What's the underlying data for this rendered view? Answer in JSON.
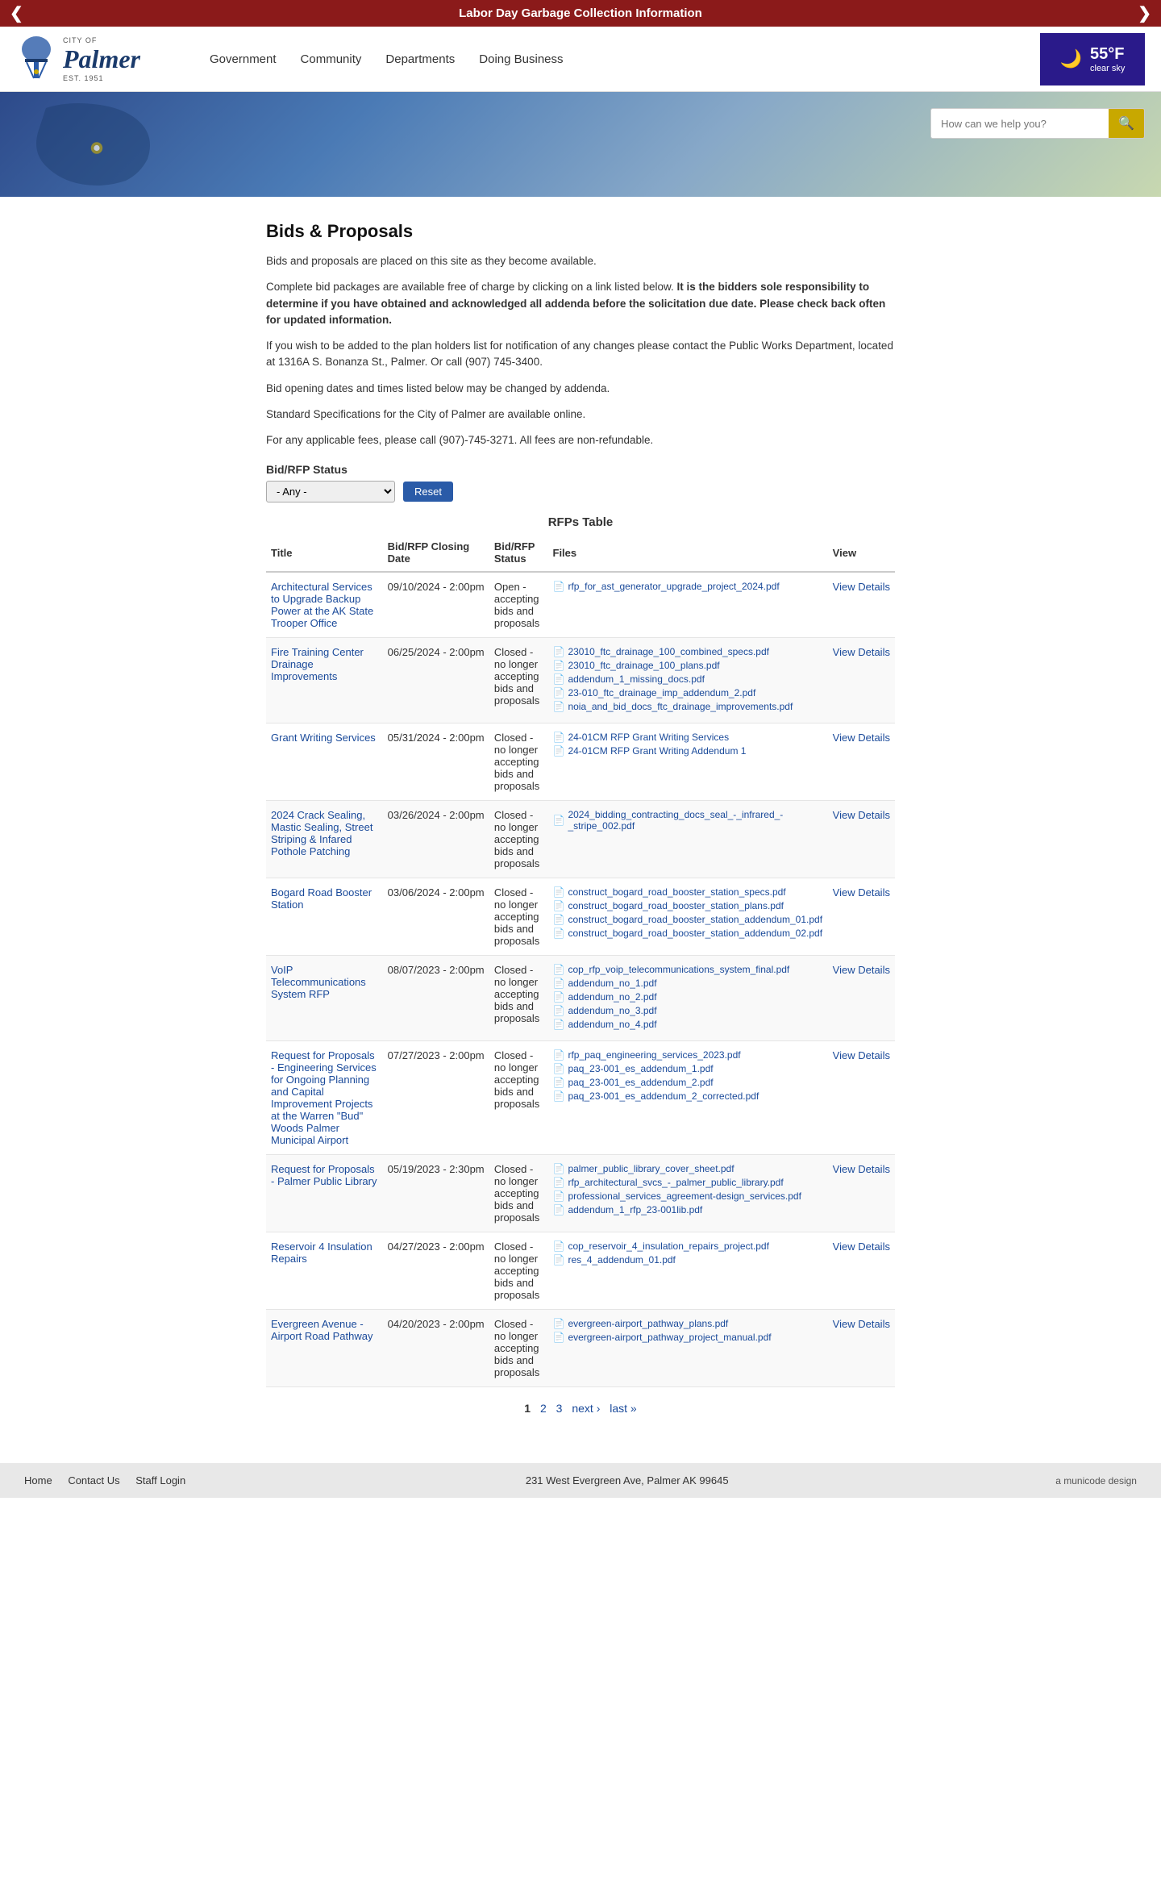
{
  "banner": {
    "text": "Labor Day Garbage Collection Information",
    "prev_label": "❮",
    "next_label": "❯"
  },
  "header": {
    "logo_city": "CITY OF",
    "logo_name": "Palmer",
    "logo_est": "EST. 1951",
    "nav_items": [
      {
        "label": "Government",
        "href": "#"
      },
      {
        "label": "Community",
        "href": "#"
      },
      {
        "label": "Departments",
        "href": "#"
      },
      {
        "label": "Doing Business",
        "href": "#"
      }
    ],
    "weather": {
      "temp": "55°F",
      "desc": "clear sky"
    },
    "search_placeholder": "How can we help you?"
  },
  "page": {
    "title": "Bids & Proposals",
    "intro_1": "Bids and proposals are placed on this site as they become available.",
    "intro_2_plain": "Complete bid packages are available free of charge by clicking on a link listed below. ",
    "intro_2_bold": "It is the bidders sole responsibility to determine if you have obtained and acknowledged all addenda before the solicitation due date. Please check back often for updated information.",
    "intro_3": "If you wish to be added to the plan holders list for notification of any changes please contact the Public Works Department, located at 1316A S. Bonanza St., Palmer. Or call (907) 745-3400.",
    "intro_4": "Bid opening dates and times listed below may be changed by addenda.",
    "intro_5": "Standard Specifications for the City of Palmer are available online.",
    "intro_6": "For any applicable fees, please call (907)-745-3271. All fees are non-refundable.",
    "filter_label": "Bid/RFP Status",
    "filter_default": "- Any -",
    "reset_label": "Reset",
    "table_title": "RFPs Table",
    "col_title": "Title",
    "col_closing": "Bid/RFP Closing Date",
    "col_status": "Bid/RFP Status",
    "col_files": "Files",
    "col_view": "View"
  },
  "rows": [
    {
      "title": "Architectural Services to Upgrade Backup Power at the AK State Trooper Office",
      "closing": "09/10/2024 - 2:00pm",
      "status": "Open - accepting bids and proposals",
      "files": [
        {
          "name": "rfp_for_ast_generator_upgrade_project_2024.pdf"
        }
      ],
      "view": "View Details"
    },
    {
      "title": "Fire Training Center Drainage Improvements",
      "closing": "06/25/2024 - 2:00pm",
      "status": "Closed - no longer accepting bids and proposals",
      "files": [
        {
          "name": "23010_ftc_drainage_100_combined_specs.pdf"
        },
        {
          "name": "23010_ftc_drainage_100_plans.pdf"
        },
        {
          "name": "addendum_1_missing_docs.pdf"
        },
        {
          "name": "23-010_ftc_drainage_imp_addendum_2.pdf"
        },
        {
          "name": "noia_and_bid_docs_ftc_drainage_improvements.pdf"
        }
      ],
      "view": "View Details"
    },
    {
      "title": "Grant Writing Services",
      "closing": "05/31/2024 - 2:00pm",
      "status": "Closed - no longer accepting bids and proposals",
      "files": [
        {
          "name": "24-01CM RFP Grant Writing Services"
        },
        {
          "name": "24-01CM RFP Grant Writing Addendum 1"
        }
      ],
      "view": "View Details"
    },
    {
      "title": "2024 Crack Sealing, Mastic Sealing, Street Striping & Infared Pothole Patching",
      "closing": "03/26/2024 - 2:00pm",
      "status": "Closed - no longer accepting bids and proposals",
      "files": [
        {
          "name": "2024_bidding_contracting_docs_seal_-_infrared_-_stripe_002.pdf"
        }
      ],
      "view": "View Details"
    },
    {
      "title": "Bogard Road Booster Station",
      "closing": "03/06/2024 - 2:00pm",
      "status": "Closed - no longer accepting bids and proposals",
      "files": [
        {
          "name": "construct_bogard_road_booster_station_specs.pdf"
        },
        {
          "name": "construct_bogard_road_booster_station_plans.pdf"
        },
        {
          "name": "construct_bogard_road_booster_station_addendum_01.pdf"
        },
        {
          "name": "construct_bogard_road_booster_station_addendum_02.pdf"
        }
      ],
      "view": "View Details"
    },
    {
      "title": "VoIP Telecommunications System RFP",
      "closing": "08/07/2023 - 2:00pm",
      "status": "Closed - no longer accepting bids and proposals",
      "files": [
        {
          "name": "cop_rfp_voip_telecommunications_system_final.pdf"
        },
        {
          "name": "addendum_no_1.pdf"
        },
        {
          "name": "addendum_no_2.pdf"
        },
        {
          "name": "addendum_no_3.pdf"
        },
        {
          "name": "addendum_no_4.pdf"
        }
      ],
      "view": "View Details"
    },
    {
      "title": "Request for Proposals - Engineering Services for Ongoing Planning and Capital Improvement Projects at the Warren \"Bud\" Woods Palmer Municipal Airport",
      "closing": "07/27/2023 - 2:00pm",
      "status": "Closed - no longer accepting bids and proposals",
      "files": [
        {
          "name": "rfp_paq_engineering_services_2023.pdf"
        },
        {
          "name": "paq_23-001_es_addendum_1.pdf"
        },
        {
          "name": "paq_23-001_es_addendum_2.pdf"
        },
        {
          "name": "paq_23-001_es_addendum_2_corrected.pdf"
        }
      ],
      "view": "View Details"
    },
    {
      "title": "Request for Proposals - Palmer Public Library",
      "closing": "05/19/2023 - 2:30pm",
      "status": "Closed - no longer accepting bids and proposals",
      "files": [
        {
          "name": "palmer_public_library_cover_sheet.pdf"
        },
        {
          "name": "rfp_architectural_svcs_-_palmer_public_library.pdf"
        },
        {
          "name": "professional_services_agreement-design_services.pdf"
        },
        {
          "name": "addendum_1_rfp_23-001lib.pdf"
        }
      ],
      "view": "View Details"
    },
    {
      "title": "Reservoir 4 Insulation Repairs",
      "closing": "04/27/2023 - 2:00pm",
      "status": "Closed - no longer accepting bids and proposals",
      "files": [
        {
          "name": "cop_reservoir_4_insulation_repairs_project.pdf"
        },
        {
          "name": "res_4_addendum_01.pdf"
        }
      ],
      "view": "View Details"
    },
    {
      "title": "Evergreen Avenue - Airport Road Pathway",
      "closing": "04/20/2023 - 2:00pm",
      "status": "Closed - no longer accepting bids and proposals",
      "files": [
        {
          "name": "evergreen-airport_pathway_plans.pdf"
        },
        {
          "name": "evergreen-airport_pathway_project_manual.pdf"
        }
      ],
      "view": "View Details"
    }
  ],
  "pagination": {
    "pages": [
      "1",
      "2",
      "3"
    ],
    "current": "1",
    "next_label": "next ›",
    "last_label": "last »"
  },
  "footer": {
    "links": [
      "Home",
      "Contact Us",
      "Staff Login"
    ],
    "address": "231 West Evergreen Ave, Palmer AK 99645",
    "brand": "a municode design"
  }
}
